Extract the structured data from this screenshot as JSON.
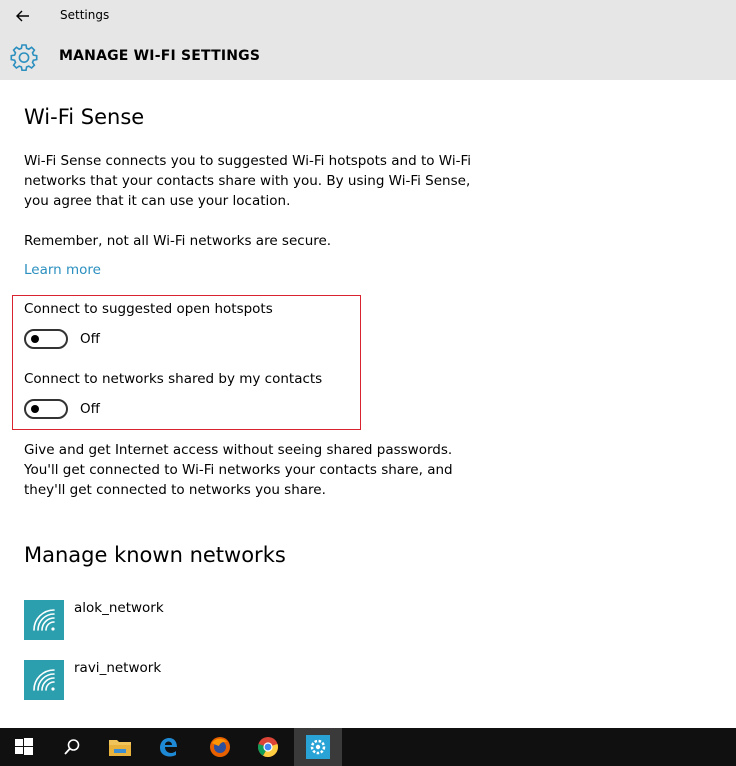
{
  "window": {
    "title": "Settings",
    "back_icon": "back-arrow-icon"
  },
  "header": {
    "icon": "gear-icon",
    "title": "MANAGE WI-FI SETTINGS"
  },
  "wifi_sense": {
    "heading": "Wi-Fi Sense",
    "description_lines": [
      "Wi-Fi Sense connects you to suggested Wi-Fi hotspots and to Wi-Fi",
      "networks that your contacts share with you. By using Wi-Fi Sense,",
      "you agree that it can use your location."
    ],
    "warning": "Remember, not all Wi-Fi networks are secure.",
    "learn_more": "Learn more",
    "toggles": [
      {
        "label": "Connect to suggested open hotspots",
        "state": "Off"
      },
      {
        "label": "Connect to networks shared by my contacts",
        "state": "Off"
      }
    ],
    "info_lines": [
      "Give and get Internet access without seeing shared passwords.",
      "You'll get connected to Wi-Fi networks your contacts share, and",
      "they'll get connected to networks you share."
    ]
  },
  "known_networks": {
    "heading": "Manage known networks",
    "items": [
      {
        "name": "alok_network",
        "icon": "wifi-icon"
      },
      {
        "name": "ravi_network",
        "icon": "wifi-icon"
      }
    ]
  },
  "colors": {
    "accent": "#2b8fbf",
    "network_tile": "#2b9fad",
    "highlight_border": "#d9232e",
    "taskbar": "#101010"
  },
  "taskbar": {
    "items": [
      "start-icon",
      "search-icon",
      "file-explorer-icon",
      "edge-icon",
      "firefox-icon",
      "chrome-icon",
      "settings-icon"
    ]
  }
}
